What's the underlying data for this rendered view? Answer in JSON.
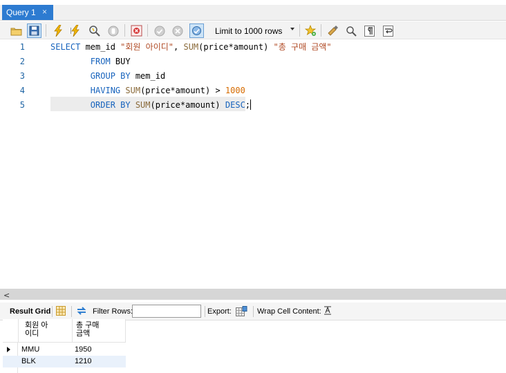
{
  "tabs": [
    {
      "label": "Query 1",
      "close": "×"
    }
  ],
  "toolbar": {
    "limit_label": "Limit to 1000 rows",
    "buttons": [
      "open-file",
      "save",
      "execute",
      "execute-current",
      "explain",
      "stop",
      "toggle-error",
      "commit",
      "rollback",
      "autocommit",
      "bookmark",
      "beautify",
      "find",
      "invisible-chars",
      "wrap"
    ]
  },
  "editor": {
    "line_numbers": [
      "1",
      "2",
      "3",
      "4",
      "5"
    ],
    "lines": [
      [
        {
          "t": "SELECT",
          "c": "kw"
        },
        {
          "t": " mem_id ",
          "c": "plain"
        },
        {
          "t": "\"회원 아이디\"",
          "c": "str"
        },
        {
          "t": ", ",
          "c": "plain"
        },
        {
          "t": "SUM",
          "c": "fn"
        },
        {
          "t": "(price*amount) ",
          "c": "plain"
        },
        {
          "t": "\"총 구매 금액\"",
          "c": "str"
        }
      ],
      [
        {
          "t": "        ",
          "c": "plain"
        },
        {
          "t": "FROM",
          "c": "kw"
        },
        {
          "t": " BUY",
          "c": "plain"
        }
      ],
      [
        {
          "t": "        ",
          "c": "plain"
        },
        {
          "t": "GROUP BY",
          "c": "kw"
        },
        {
          "t": " mem_id",
          "c": "plain"
        }
      ],
      [
        {
          "t": "        ",
          "c": "plain"
        },
        {
          "t": "HAVING",
          "c": "kw"
        },
        {
          "t": " ",
          "c": "plain"
        },
        {
          "t": "SUM",
          "c": "fn"
        },
        {
          "t": "(price*amount) > ",
          "c": "plain"
        },
        {
          "t": "1000",
          "c": "num"
        }
      ],
      [
        {
          "t": "        ",
          "c": "plain"
        },
        {
          "t": "ORDER BY",
          "c": "kw"
        },
        {
          "t": " ",
          "c": "plain"
        },
        {
          "t": "SUM",
          "c": "fn"
        },
        {
          "t": "(price*amount) ",
          "c": "plain"
        },
        {
          "t": "DESC",
          "c": "kw"
        },
        {
          "t": ";",
          "c": "plain"
        }
      ]
    ]
  },
  "scroll_arrow": "<",
  "result_bar": {
    "result_grid": "Result Grid",
    "filter_rows": "Filter Rows:",
    "filter_value": "",
    "export": "Export:",
    "wrap_cell": "Wrap Cell Content:"
  },
  "grid": {
    "columns": [
      "회원 아\n이디",
      "총 구매\n금액"
    ],
    "rows": [
      [
        "MMU",
        "1950"
      ],
      [
        "BLK",
        "1210"
      ]
    ]
  },
  "colors": {
    "tab_active": "#2d7bd1",
    "keyword": "#1763bd",
    "string": "#b04a24",
    "number": "#d66b00",
    "line_number": "#1e64a4",
    "row_alt": "#e9f1fb"
  }
}
